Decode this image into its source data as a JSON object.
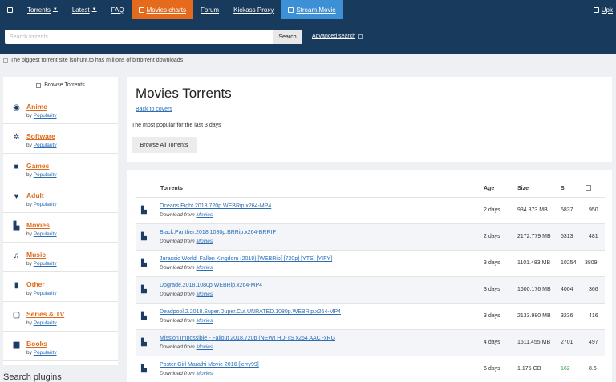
{
  "nav": {
    "items": [
      {
        "label": "Torrents",
        "caret": true
      },
      {
        "label": "Latest",
        "caret": true
      },
      {
        "label": "FAQ"
      },
      {
        "label": "Movies charts"
      },
      {
        "label": "Forum"
      },
      {
        "label": "Kickass Proxy"
      },
      {
        "label": "Stream Movie"
      },
      {
        "label": "Upk"
      }
    ],
    "accent_orange": "#e66a1c",
    "accent_blue": "#3d8fd6",
    "bar_color": "#183a5c"
  },
  "search": {
    "placeholder": "Search torrents",
    "button_label": "Search",
    "advanced_label": "Advanced search"
  },
  "tagline": "The biggest torrent site isohunt.to has millions of bittorrent downloads",
  "sidebar": {
    "header": "Browse Torrents",
    "by_text": "by",
    "popularity_label": "Popularity",
    "items": [
      {
        "label": "Anime",
        "icon": "anime-icon"
      },
      {
        "label": "Software",
        "icon": "gear-icon"
      },
      {
        "label": "Games",
        "icon": "gamepad-icon"
      },
      {
        "label": "Adult",
        "icon": "heart-icon"
      },
      {
        "label": "Movies",
        "icon": "film-icon"
      },
      {
        "label": "Music",
        "icon": "music-icon"
      },
      {
        "label": "Other",
        "icon": "file-icon"
      },
      {
        "label": "Series & TV",
        "icon": "tv-icon"
      },
      {
        "label": "Books",
        "icon": "book-icon"
      }
    ],
    "search_plugins": "Search plugins"
  },
  "main": {
    "title": "Movies Torrents",
    "back_link": "Back to covers",
    "popular_text": "The most popular for the last 3 days",
    "browse_all": "Browse All Torrents"
  },
  "table": {
    "headers": {
      "name": "Torrents",
      "age": "Age",
      "size": "Size",
      "seeds": "S"
    },
    "download_from": "Download from",
    "category_link": "Movies",
    "rows": [
      {
        "name": "Oceans.Eight.2018.720p.WEBRip.x264-MP4",
        "age": "2 days",
        "size": "934.873 MB",
        "seeds": "5837",
        "leech": "950"
      },
      {
        "name": "Black.Panther.2018.1080p.BRRip.x264-BRRIP",
        "age": "2 days",
        "size": "2172.779 MB",
        "seeds": "5313",
        "leech": "481"
      },
      {
        "name": "Jurassic World: Fallen Kingdom (2018) [WEBRip] [720p] [YTS] [YIFY]",
        "age": "3 days",
        "size": "1101.483 MB",
        "seeds": "10254",
        "leech": "3809"
      },
      {
        "name": "Upgrade.2018.1080p.WEBRip.x264-MP4",
        "age": "3 days",
        "size": "1600.176 MB",
        "seeds": "4004",
        "leech": "366"
      },
      {
        "name": "Deadpool.2.2018.Super.Duper.Cut.UNRATED.1080p.WEBRip.x264-MP4",
        "age": "3 days",
        "size": "2133.980 MB",
        "seeds": "3236",
        "leech": "416"
      },
      {
        "name": "Mission Impossible - Fallout 2018.720p (NEW) HD-TS x264 AAC -xRG",
        "age": "4 days",
        "size": "1511.455 MB",
        "seeds": "2701",
        "leech": "497"
      },
      {
        "name": "Poster Girl Marathi Movie 2016 [jerry99]",
        "age": "6 days",
        "size": "1.175 GB",
        "seeds": "162",
        "leech": "8.6"
      }
    ]
  }
}
